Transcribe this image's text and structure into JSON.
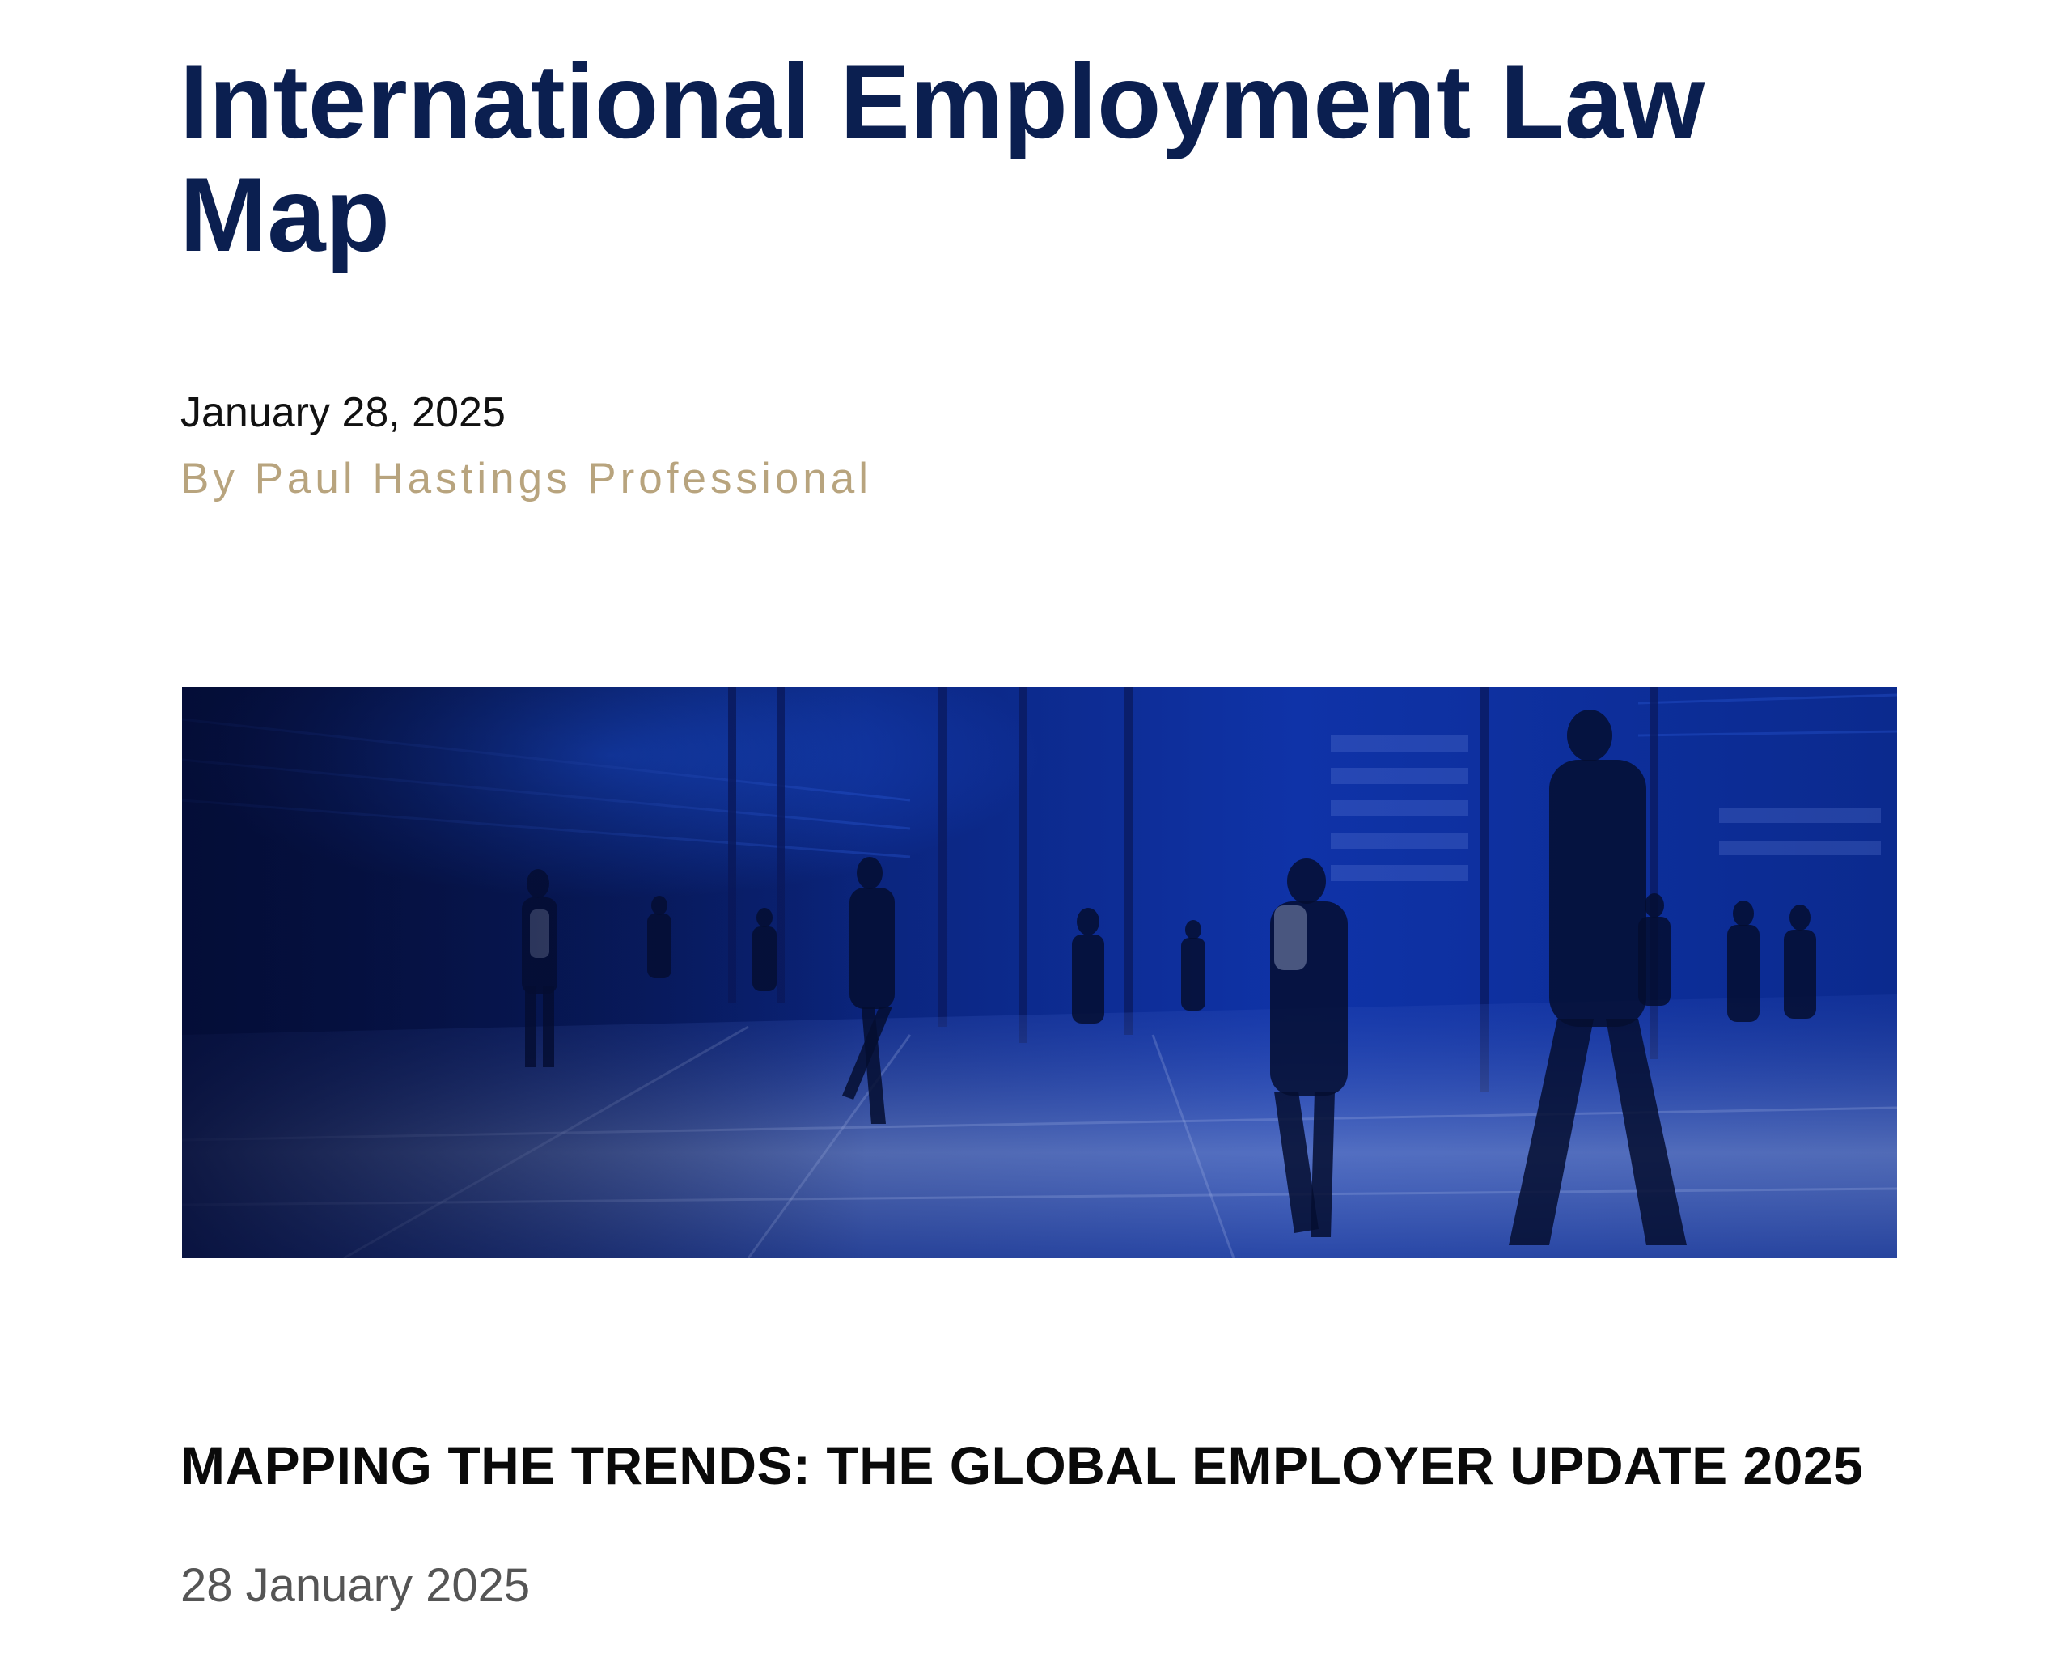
{
  "article": {
    "title": "International Employment Law Map",
    "date": "January 28, 2025",
    "byline_prefix": "By ",
    "author": "Paul Hastings Professional"
  },
  "hero": {
    "description_icon": "office-commuters-photo"
  },
  "section": {
    "heading": "MAPPING THE TRENDS: THE GLOBAL EMPLOYER UPDATE 2025",
    "date": "28 January 2025"
  },
  "colors": {
    "title": "#0b1f50",
    "byline": "#b8a47e",
    "hero_base": "#0a1a5a"
  }
}
